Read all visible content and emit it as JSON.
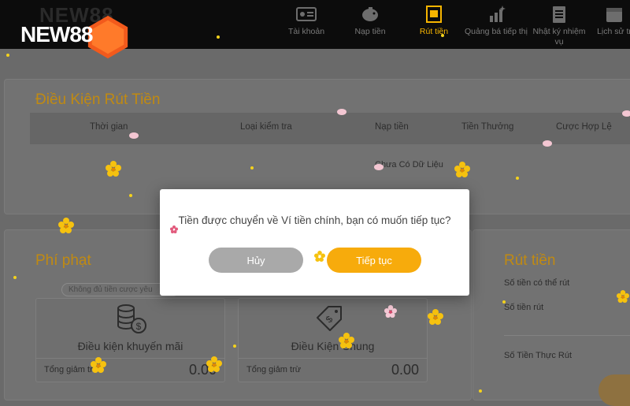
{
  "header": {
    "logo_text": "NEW88",
    "nav": [
      {
        "label": "Tài khoản",
        "icon": "id-card-icon",
        "active": false
      },
      {
        "label": "Nạp tiền",
        "icon": "piggy-bank-icon",
        "active": false
      },
      {
        "label": "Rút tiền",
        "icon": "withdraw-icon",
        "active": true
      },
      {
        "label": "Quảng bá tiếp thị",
        "icon": "sparkle-chart-icon",
        "active": false
      },
      {
        "label": "Nhật ký nhiệm vụ",
        "icon": "clipboard-icon",
        "active": false
      },
      {
        "label": "Lịch sử tr",
        "icon": "calendar-icon",
        "active": false
      }
    ]
  },
  "conditions": {
    "title": "Điều Kiện Rút Tiền",
    "columns": [
      "Thời gian",
      "Loại kiểm tra",
      "Nạp tiền",
      "Tiền Thưởng",
      "Cược Hợp Lệ"
    ],
    "empty_text": "Chưa Có Dữ Liệu"
  },
  "penalty": {
    "title": "Phí phạt",
    "badge": "Không đủ tiền cược yêu",
    "cards": [
      {
        "label": "Điều kiện khuyến mãi",
        "icon": "coins-dollar-icon",
        "total_label": "Tổng giảm trừ",
        "total_value": "0.00"
      },
      {
        "label": "Điều Kiện Chung",
        "icon": "dollar-tag-icon",
        "total_label": "Tổng giảm trừ",
        "total_value": "0.00"
      }
    ]
  },
  "withdraw": {
    "title": "Rút tiền",
    "available_label": "Số tiền có thể rút",
    "amount_label": "Số tiền rút",
    "actual_label": "Số Tiền Thực Rút"
  },
  "modal": {
    "message": "Tiền được chuyển về Ví tiền chính, bạn có muốn tiếp tục?",
    "cancel_label": "Hủy",
    "confirm_label": "Tiếp tục"
  },
  "colors": {
    "accent": "#f7ab0c",
    "title_gold": "#c08a12",
    "header_bg": "#0c0c0c",
    "cancel_gray": "#a9a9a9"
  }
}
